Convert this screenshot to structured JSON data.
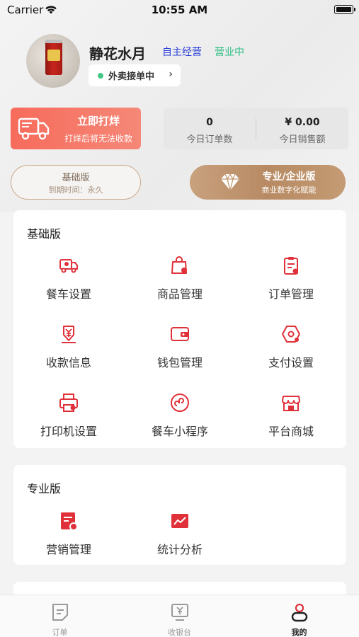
{
  "status_bar": {
    "carrier": "Carrier",
    "time": "10:55 AM"
  },
  "profile": {
    "shop_name": "静花水月",
    "tag_self_operated": "自主经营",
    "tag_status": "营业中",
    "delivery_status": "外卖接单中"
  },
  "print_card": {
    "title": "立即打烊",
    "subtitle": "打烊后将无法收款"
  },
  "stats": [
    {
      "value": "0",
      "label": "今日订单数"
    },
    {
      "value": "¥ 0.00",
      "label": "今日销售额"
    }
  ],
  "basic_plan": {
    "title": "基础版",
    "expiry": "到期时间：永久"
  },
  "pro_plan": {
    "title": "专业/企业版",
    "subtitle": "商业数字化赋能"
  },
  "basic_section": {
    "title": "基础版",
    "items": [
      {
        "label": "餐车设置",
        "icon": "food-truck-settings-icon"
      },
      {
        "label": "商品管理",
        "icon": "shopping-bag-icon"
      },
      {
        "label": "订单管理",
        "icon": "clipboard-icon"
      },
      {
        "label": "收款信息",
        "icon": "yen-download-icon"
      },
      {
        "label": "钱包管理",
        "icon": "wallet-icon"
      },
      {
        "label": "支付设置",
        "icon": "hexagon-settings-icon"
      },
      {
        "label": "打印机设置",
        "icon": "printer-icon"
      },
      {
        "label": "餐车小程序",
        "icon": "mini-program-icon"
      },
      {
        "label": "平台商城",
        "icon": "store-icon"
      }
    ]
  },
  "pro_section": {
    "title": "专业版",
    "items": [
      {
        "label": "营销管理",
        "icon": "marketing-icon"
      },
      {
        "label": "统计分析",
        "icon": "chart-icon"
      }
    ]
  },
  "tabbar": {
    "items": [
      {
        "label": "订单",
        "icon": "order-icon",
        "active": false
      },
      {
        "label": "收银台",
        "icon": "cashier-icon",
        "active": false
      },
      {
        "label": "我的",
        "icon": "profile-icon",
        "active": true
      }
    ]
  },
  "colors": {
    "accent_red": "#e0313a",
    "print_card": "#f76b5b",
    "gold": "#c29a73",
    "open_green": "#2fbf86",
    "self_blue": "#2b3fd8"
  }
}
